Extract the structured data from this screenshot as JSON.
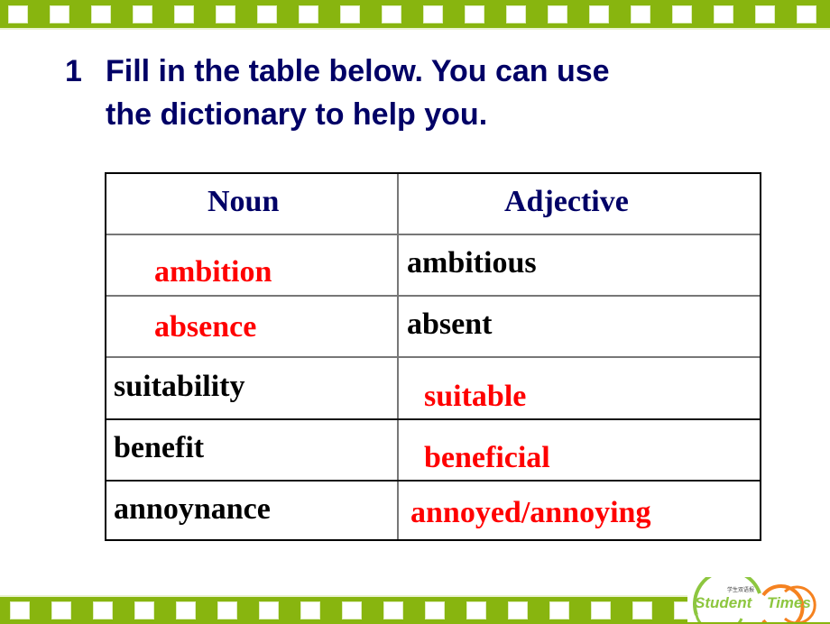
{
  "slide": {
    "number": "1",
    "instruction_line1": "Fill in the table below. You can use",
    "instruction_line2": "the dictionary to help you."
  },
  "table": {
    "headers": [
      "Noun",
      "Adjective"
    ],
    "rows": [
      {
        "noun": "ambition",
        "noun_is_answer": true,
        "adjective": "ambitious",
        "adjective_is_answer": false
      },
      {
        "noun": "absence",
        "noun_is_answer": true,
        "adjective": "absent",
        "adjective_is_answer": false
      },
      {
        "noun": "suitability",
        "noun_is_answer": false,
        "adjective": "suitable",
        "adjective_is_answer": true
      },
      {
        "noun": "benefit",
        "noun_is_answer": false,
        "adjective": "beneficial",
        "adjective_is_answer": true
      },
      {
        "noun": "annoynance",
        "noun_is_answer": false,
        "adjective": "annoyed/annoying",
        "adjective_is_answer": true
      }
    ]
  },
  "logo": {
    "name_part1": "Student",
    "name_part2": "Times",
    "chinese": "学生双语报"
  },
  "colors": {
    "band": "#88b50f",
    "title": "#000066",
    "answer": "#ff0000",
    "given": "#000000",
    "logo_green": "#8dc63f",
    "logo_orange": "#f58220"
  }
}
